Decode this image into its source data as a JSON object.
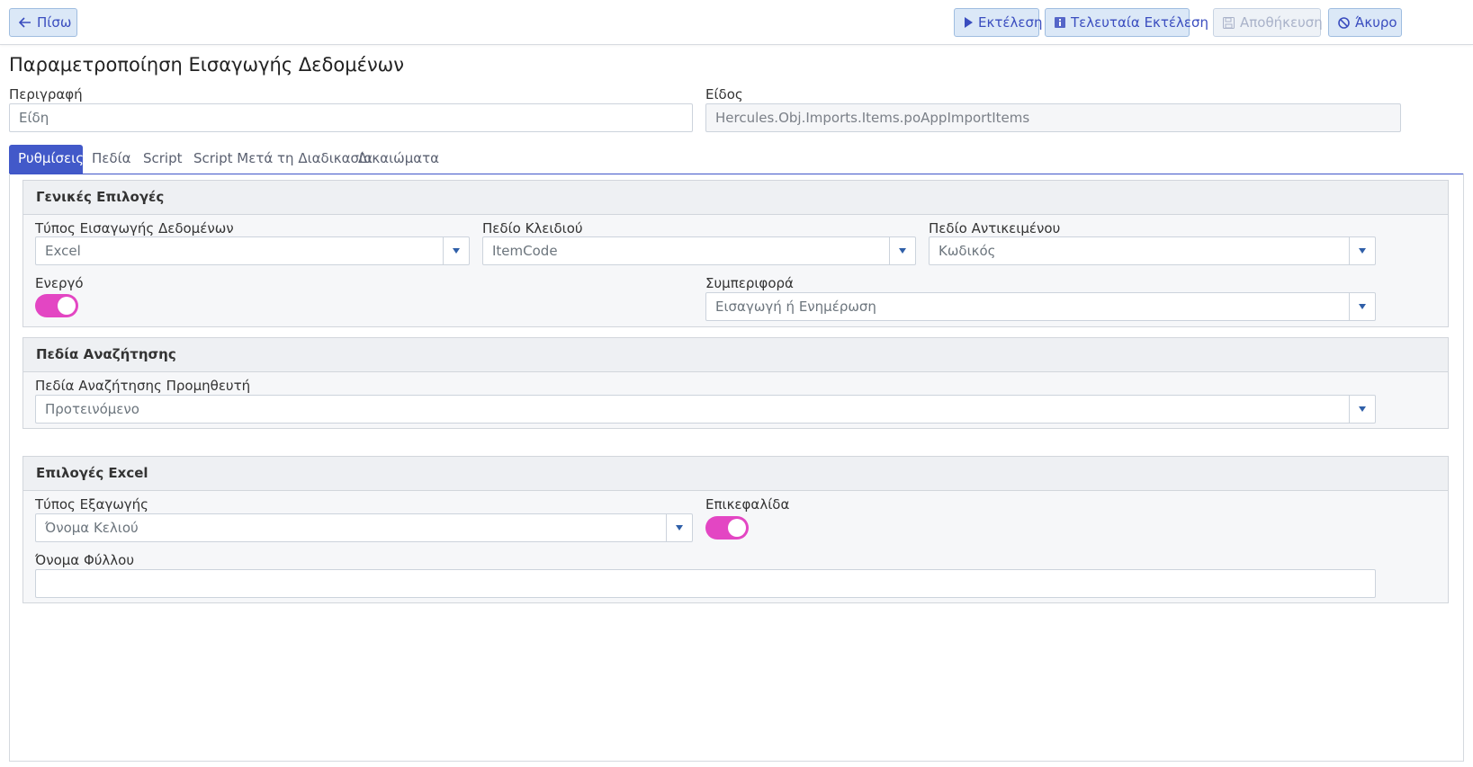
{
  "toolbar": {
    "back_label": "Πίσω",
    "run_label": "Εκτέλεση",
    "last_run_label": "Τελευταία Εκτέλεση",
    "save_label": "Αποθήκευση",
    "cancel_label": "Άκυρο"
  },
  "page": {
    "title": "Παραμετροποίηση Εισαγωγής Δεδομένων"
  },
  "form": {
    "description_label": "Περιγραφή",
    "description_value": "Είδη",
    "type_label": "Είδος",
    "type_value": "Hercules.Obj.Imports.Items.poAppImportItems"
  },
  "tabs": [
    {
      "label": "Ρυθμίσεις",
      "active": true
    },
    {
      "label": "Πεδία"
    },
    {
      "label": "Script"
    },
    {
      "label": "Script Μετά τη Διαδικασία"
    },
    {
      "label": "Δικαιώματα"
    }
  ],
  "general": {
    "title": "Γενικές Επιλογές",
    "import_type_label": "Τύπος Εισαγωγής Δεδομένων",
    "import_type_value": "Excel",
    "key_field_label": "Πεδίο Κλειδιού",
    "key_field_value": "ItemCode",
    "object_field_label": "Πεδίο Αντικειμένου",
    "object_field_value": "Κωδικός",
    "active_label": "Ενεργό",
    "active_on": true,
    "behavior_label": "Συμπεριφορά",
    "behavior_value": "Εισαγωγή ή Ενημέρωση"
  },
  "search": {
    "title": "Πεδία Αναζήτησης",
    "supplier_label": "Πεδία Αναζήτησης Προμηθευτή",
    "supplier_value": "Προτεινόμενο"
  },
  "excel": {
    "title": "Επιλογές Excel",
    "export_type_label": "Τύπος Εξαγωγής",
    "export_type_value": "Όνομα Κελιού",
    "header_label": "Επικεφαλίδα",
    "header_on": true,
    "sheet_name_label": "Όνομα Φύλλου",
    "sheet_name_value": ""
  },
  "colors": {
    "accent": "#4259c9",
    "toggle": "#e346c3"
  }
}
